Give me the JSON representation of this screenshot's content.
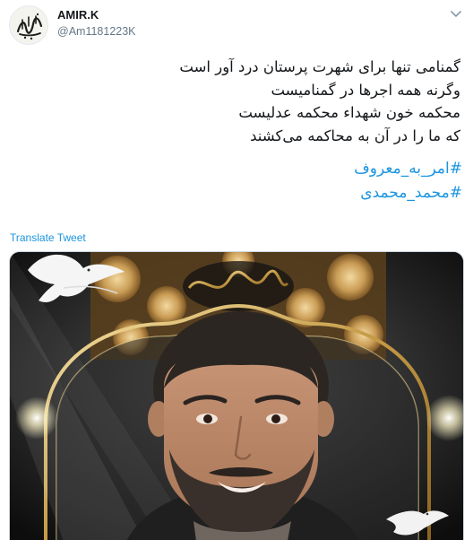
{
  "tweet": {
    "author": {
      "display_name": "AMIR.K",
      "handle": "@Am1181223K",
      "avatar_icon": "calligraphy-avatar-icon"
    },
    "menu_icon": "chevron-down-icon",
    "body_lines": [
      "گمنامی تنها برای شهرت پرستان درد آور است",
      "وگرنه همه اجرها در گمنامیست",
      "محکمه خون شهداء محکمه عدلیست",
      "که ما را در آن به محاکمه می‌کشند"
    ],
    "hashtags": [
      "#امر_به_معروف",
      "#محمد_محمدی"
    ],
    "translate_label": "Translate Tweet",
    "media": {
      "description_icon": "memorial-photo-image"
    },
    "colors": {
      "link": "#1b95e0",
      "text": "#14171a",
      "secondary": "#657786"
    }
  }
}
